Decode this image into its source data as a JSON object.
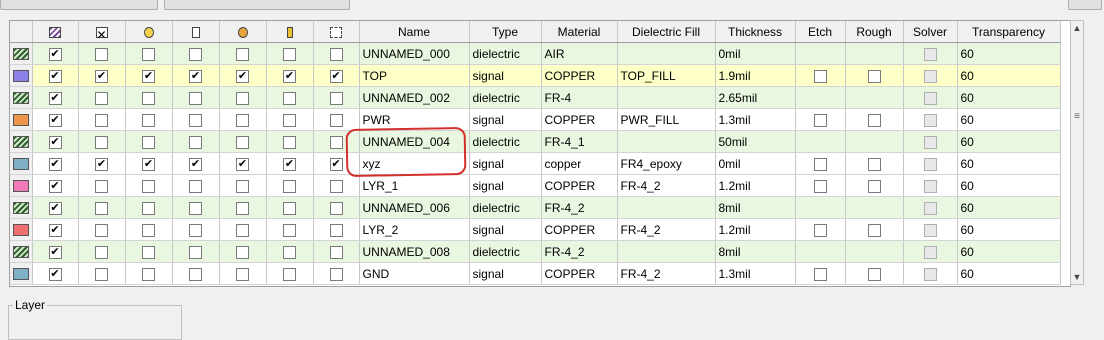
{
  "columns": {
    "icon_cols": [
      "layer-color-icon",
      "lock-icon",
      "visible-icon",
      "pad-icon",
      "via-icon",
      "trace-icon",
      "plane-icon",
      "route-icon"
    ],
    "name": "Name",
    "type": "Type",
    "material": "Material",
    "dielectric_fill": "Dielectric Fill",
    "thickness": "Thickness",
    "etch": "Etch",
    "rough": "Rough",
    "solver": "Solver",
    "transparency": "Transparency"
  },
  "rows": [
    {
      "swatch": "#2e5e2e",
      "hatch": true,
      "checks": [
        1,
        0,
        0,
        0,
        0,
        0,
        0
      ],
      "name": "UNNAMED_000",
      "type": "dielectric",
      "material": "AIR",
      "fill": "",
      "thickness": "0mil",
      "etch": false,
      "rough": false,
      "transparency": "60"
    },
    {
      "swatch": "#8a80e8",
      "hatch": false,
      "checks": [
        1,
        1,
        1,
        1,
        1,
        1,
        1
      ],
      "name": "TOP",
      "type": "signal",
      "material": "COPPER",
      "fill": "TOP_FILL",
      "thickness": "1.9mil",
      "etch": true,
      "rough": true,
      "transparency": "60",
      "selected": true
    },
    {
      "swatch": "#2e5e2e",
      "hatch": true,
      "checks": [
        1,
        0,
        0,
        0,
        0,
        0,
        0
      ],
      "name": "UNNAMED_002",
      "type": "dielectric",
      "material": "FR-4",
      "fill": "",
      "thickness": "2.65mil",
      "etch": false,
      "rough": false,
      "transparency": "60"
    },
    {
      "swatch": "#f0964a",
      "hatch": false,
      "checks": [
        1,
        0,
        0,
        0,
        0,
        0,
        0
      ],
      "name": "PWR",
      "type": "signal",
      "material": "COPPER",
      "fill": "PWR_FILL",
      "thickness": "1.3mil",
      "etch": true,
      "rough": true,
      "transparency": "60"
    },
    {
      "swatch": "#2e5e2e",
      "hatch": true,
      "checks": [
        1,
        0,
        0,
        0,
        0,
        0,
        0
      ],
      "name": "UNNAMED_004",
      "type": "dielectric",
      "material": "FR-4_1",
      "fill": "",
      "thickness": "50mil",
      "etch": false,
      "rough": false,
      "transparency": "60"
    },
    {
      "swatch": "#7fb0c8",
      "hatch": false,
      "checks": [
        1,
        1,
        1,
        1,
        1,
        1,
        1
      ],
      "name": "xyz",
      "type": "signal",
      "material": "copper",
      "fill": "FR4_epoxy",
      "thickness": "0mil",
      "etch": true,
      "rough": true,
      "transparency": "60"
    },
    {
      "swatch": "#f07ab8",
      "hatch": false,
      "checks": [
        1,
        0,
        0,
        0,
        0,
        0,
        0
      ],
      "name": "LYR_1",
      "type": "signal",
      "material": "COPPER",
      "fill": "FR-4_2",
      "thickness": "1.2mil",
      "etch": true,
      "rough": true,
      "transparency": "60"
    },
    {
      "swatch": "#2e5e2e",
      "hatch": true,
      "checks": [
        1,
        0,
        0,
        0,
        0,
        0,
        0
      ],
      "name": "UNNAMED_006",
      "type": "dielectric",
      "material": "FR-4_2",
      "fill": "",
      "thickness": "8mil",
      "etch": false,
      "rough": false,
      "transparency": "60"
    },
    {
      "swatch": "#f07070",
      "hatch": false,
      "checks": [
        1,
        0,
        0,
        0,
        0,
        0,
        0
      ],
      "name": "LYR_2",
      "type": "signal",
      "material": "COPPER",
      "fill": "FR-4_2",
      "thickness": "1.2mil",
      "etch": true,
      "rough": true,
      "transparency": "60"
    },
    {
      "swatch": "#2e5e2e",
      "hatch": true,
      "checks": [
        1,
        0,
        0,
        0,
        0,
        0,
        0
      ],
      "name": "UNNAMED_008",
      "type": "dielectric",
      "material": "FR-4_2",
      "fill": "",
      "thickness": "8mil",
      "etch": false,
      "rough": false,
      "transparency": "60"
    },
    {
      "swatch": "#7fb0c8",
      "hatch": false,
      "checks": [
        1,
        0,
        0,
        0,
        0,
        0,
        0
      ],
      "name": "GND",
      "type": "signal",
      "material": "COPPER",
      "fill": "FR-4_2",
      "thickness": "1.3mil",
      "etch": true,
      "rough": true,
      "transparency": "60"
    }
  ],
  "layer_group_label": "Layer",
  "colors": {
    "dielectric_row": "#e9f7e0",
    "selected_row": "#ffffc8",
    "annotation": "#d2302d"
  }
}
